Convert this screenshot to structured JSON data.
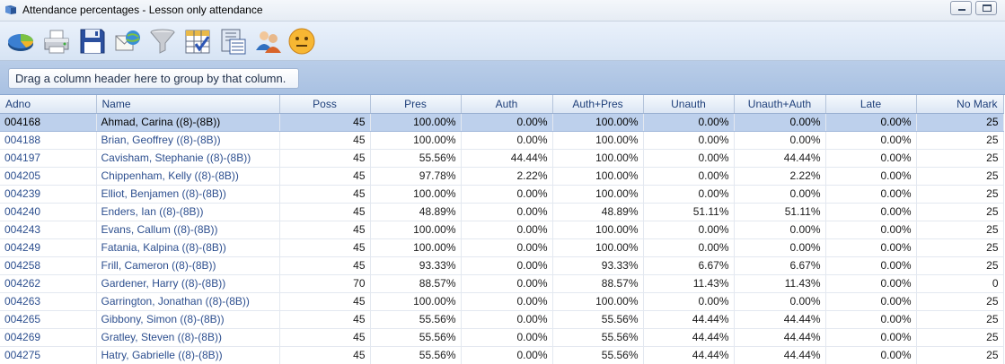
{
  "window": {
    "title": "Attendance percentages - Lesson only attendance"
  },
  "toolbar": {
    "buttons": [
      {
        "name": "chart-icon"
      },
      {
        "name": "print-icon"
      },
      {
        "name": "save-icon"
      },
      {
        "name": "email-icon"
      },
      {
        "name": "filter-icon"
      },
      {
        "name": "select-columns-icon"
      },
      {
        "name": "export-icon"
      },
      {
        "name": "users-icon"
      },
      {
        "name": "smiley-icon"
      }
    ]
  },
  "group_panel": {
    "text": "Drag a column header here to group by that column."
  },
  "table": {
    "columns": [
      "Adno",
      "Name",
      "Poss",
      "Pres",
      "Auth",
      "Auth+Pres",
      "Unauth",
      "Unauth+Auth",
      "Late",
      "No Mark"
    ],
    "rows": [
      {
        "adno": "004168",
        "name": "Ahmad, Carina ((8)-(8B))",
        "poss": "45",
        "pres": "100.00%",
        "auth": "0.00%",
        "auth_pres": "100.00%",
        "unauth": "0.00%",
        "unauth_auth": "0.00%",
        "late": "0.00%",
        "no_mark": "25",
        "selected": true
      },
      {
        "adno": "004188",
        "name": "Brian, Geoffrey ((8)-(8B))",
        "poss": "45",
        "pres": "100.00%",
        "auth": "0.00%",
        "auth_pres": "100.00%",
        "unauth": "0.00%",
        "unauth_auth": "0.00%",
        "late": "0.00%",
        "no_mark": "25"
      },
      {
        "adno": "004197",
        "name": "Cavisham, Stephanie ((8)-(8B))",
        "poss": "45",
        "pres": "55.56%",
        "auth": "44.44%",
        "auth_pres": "100.00%",
        "unauth": "0.00%",
        "unauth_auth": "44.44%",
        "late": "0.00%",
        "no_mark": "25"
      },
      {
        "adno": "004205",
        "name": "Chippenham, Kelly ((8)-(8B))",
        "poss": "45",
        "pres": "97.78%",
        "auth": "2.22%",
        "auth_pres": "100.00%",
        "unauth": "0.00%",
        "unauth_auth": "2.22%",
        "late": "0.00%",
        "no_mark": "25"
      },
      {
        "adno": "004239",
        "name": "Elliot, Benjamen ((8)-(8B))",
        "poss": "45",
        "pres": "100.00%",
        "auth": "0.00%",
        "auth_pres": "100.00%",
        "unauth": "0.00%",
        "unauth_auth": "0.00%",
        "late": "0.00%",
        "no_mark": "25"
      },
      {
        "adno": "004240",
        "name": "Enders, Ian ((8)-(8B))",
        "poss": "45",
        "pres": "48.89%",
        "auth": "0.00%",
        "auth_pres": "48.89%",
        "unauth": "51.11%",
        "unauth_auth": "51.11%",
        "late": "0.00%",
        "no_mark": "25"
      },
      {
        "adno": "004243",
        "name": "Evans, Callum ((8)-(8B))",
        "poss": "45",
        "pres": "100.00%",
        "auth": "0.00%",
        "auth_pres": "100.00%",
        "unauth": "0.00%",
        "unauth_auth": "0.00%",
        "late": "0.00%",
        "no_mark": "25"
      },
      {
        "adno": "004249",
        "name": "Fatania, Kalpina ((8)-(8B))",
        "poss": "45",
        "pres": "100.00%",
        "auth": "0.00%",
        "auth_pres": "100.00%",
        "unauth": "0.00%",
        "unauth_auth": "0.00%",
        "late": "0.00%",
        "no_mark": "25"
      },
      {
        "adno": "004258",
        "name": "Frill, Cameron ((8)-(8B))",
        "poss": "45",
        "pres": "93.33%",
        "auth": "0.00%",
        "auth_pres": "93.33%",
        "unauth": "6.67%",
        "unauth_auth": "6.67%",
        "late": "0.00%",
        "no_mark": "25"
      },
      {
        "adno": "004262",
        "name": "Gardener, Harry ((8)-(8B))",
        "poss": "70",
        "pres": "88.57%",
        "auth": "0.00%",
        "auth_pres": "88.57%",
        "unauth": "11.43%",
        "unauth_auth": "11.43%",
        "late": "0.00%",
        "no_mark": "0"
      },
      {
        "adno": "004263",
        "name": "Garrington, Jonathan ((8)-(8B))",
        "poss": "45",
        "pres": "100.00%",
        "auth": "0.00%",
        "auth_pres": "100.00%",
        "unauth": "0.00%",
        "unauth_auth": "0.00%",
        "late": "0.00%",
        "no_mark": "25"
      },
      {
        "adno": "004265",
        "name": "Gibbony, Simon ((8)-(8B))",
        "poss": "45",
        "pres": "55.56%",
        "auth": "0.00%",
        "auth_pres": "55.56%",
        "unauth": "44.44%",
        "unauth_auth": "44.44%",
        "late": "0.00%",
        "no_mark": "25"
      },
      {
        "adno": "004269",
        "name": "Gratley, Steven ((8)-(8B))",
        "poss": "45",
        "pres": "55.56%",
        "auth": "0.00%",
        "auth_pres": "55.56%",
        "unauth": "44.44%",
        "unauth_auth": "44.44%",
        "late": "0.00%",
        "no_mark": "25"
      },
      {
        "adno": "004275",
        "name": "Hatry, Gabrielle ((8)-(8B))",
        "poss": "45",
        "pres": "55.56%",
        "auth": "0.00%",
        "auth_pres": "55.56%",
        "unauth": "44.44%",
        "unauth_auth": "44.44%",
        "late": "0.00%",
        "no_mark": "25"
      }
    ]
  }
}
